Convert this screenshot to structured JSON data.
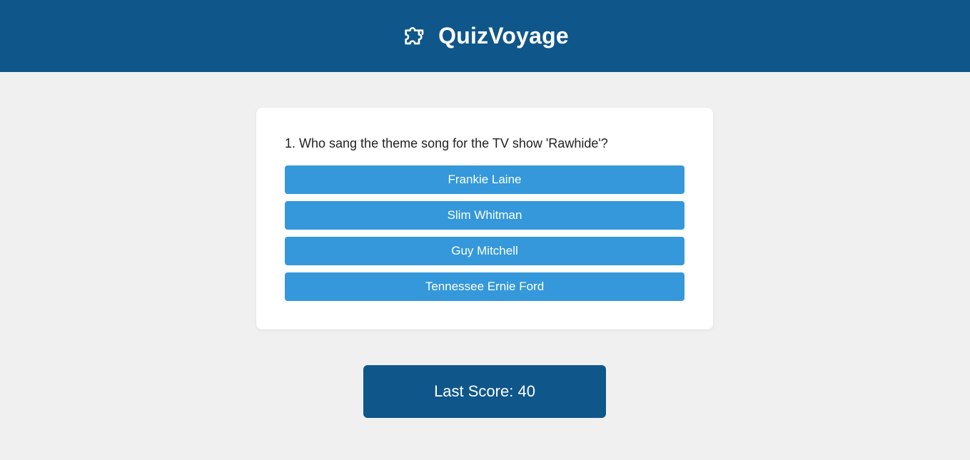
{
  "header": {
    "brand_icon": "puzzle-piece-icon",
    "title": "QuizVoyage",
    "background_color": "#0f568a"
  },
  "quiz": {
    "question": "1. Who sang the theme song for the TV show 'Rawhide'?",
    "options": [
      {
        "label": "Frankie Laine"
      },
      {
        "label": "Slim Whitman"
      },
      {
        "label": "Guy Mitchell"
      },
      {
        "label": "Tennessee Ernie Ford"
      }
    ],
    "option_color": "#3498db"
  },
  "score": {
    "label": "Last Score: 40"
  }
}
